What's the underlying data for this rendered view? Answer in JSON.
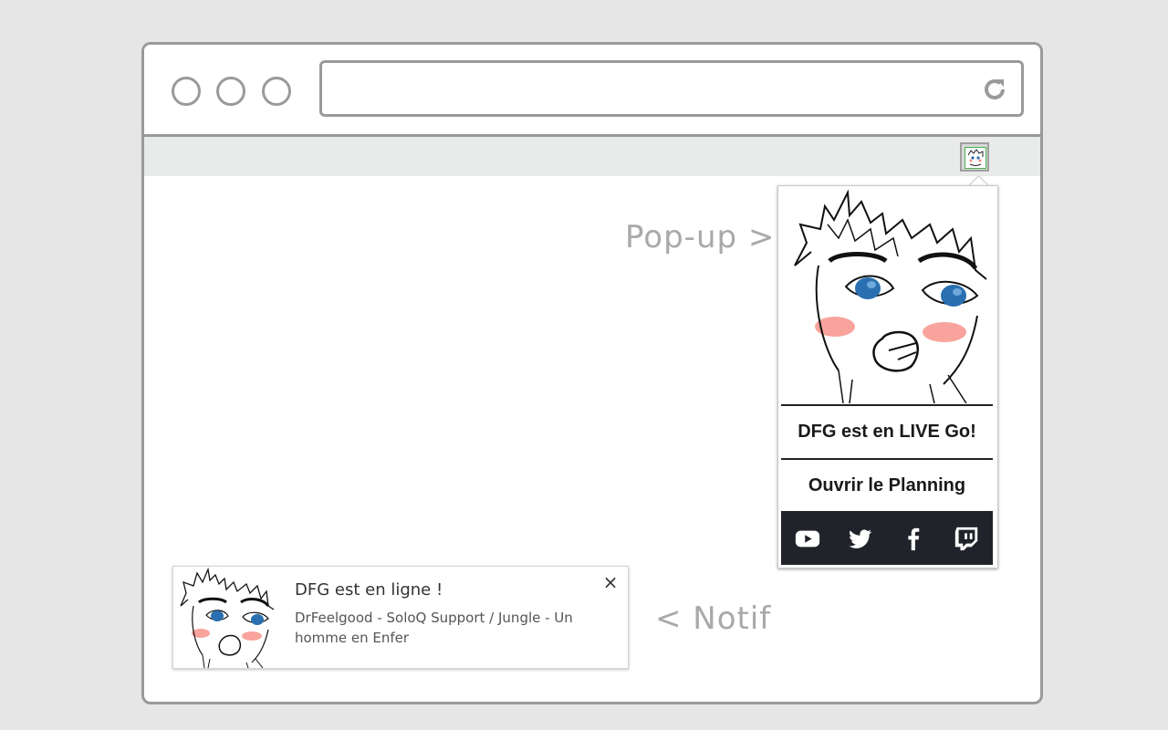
{
  "labels": {
    "popup": "Pop-up >",
    "notif": "< Notif"
  },
  "popup": {
    "live_label": "DFG est en LIVE Go!",
    "planning_label": "Ouvrir le Planning",
    "social_icons": [
      "youtube-icon",
      "twitter-icon",
      "facebook-icon",
      "twitch-icon"
    ]
  },
  "notification": {
    "title": "DFG est en ligne !",
    "body": "DrFeelgood - SoloQ Support / Jungle - Un homme en Enfer",
    "close": "×"
  },
  "colors": {
    "background": "#e6e6e6",
    "frame": "#9a9a9a",
    "toolbar": "#e9eaea",
    "social_bar": "#20232a",
    "eyes": "#2a6fb0",
    "blush": "#f25a4a",
    "label": "#a9a9a9"
  }
}
